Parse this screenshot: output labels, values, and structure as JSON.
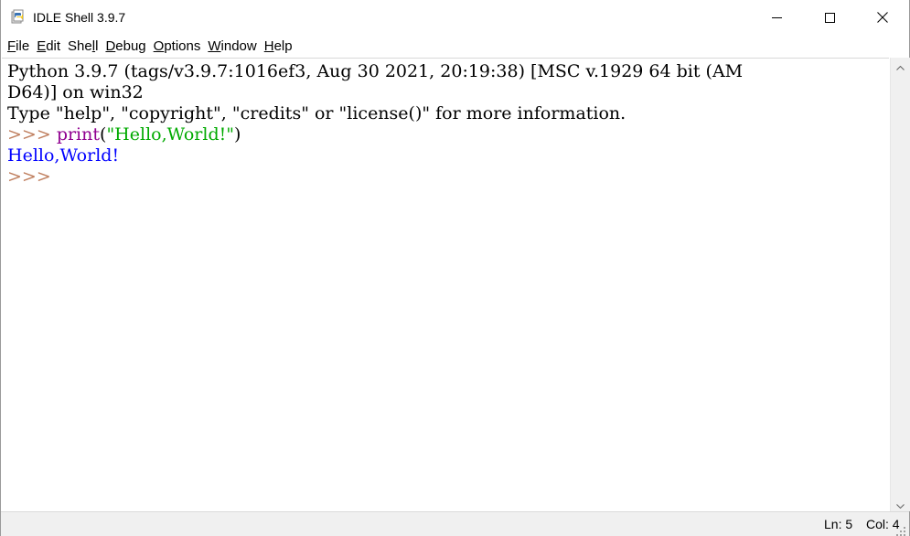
{
  "window": {
    "title": "IDLE Shell 3.9.7"
  },
  "icons": {
    "app": "python-idle-icon",
    "minimize": "minimize-icon",
    "maximize": "maximize-icon",
    "close": "close-icon",
    "scroll_up": "arrow-up-icon",
    "scroll_down": "arrow-down-icon",
    "grip": "resize-grip-icon"
  },
  "menu": {
    "items": [
      {
        "first": "F",
        "rest": "ile"
      },
      {
        "first": "E",
        "rest": "dit"
      },
      {
        "pre": "She",
        "first": "l",
        "rest": "l"
      },
      {
        "first": "D",
        "rest": "ebug"
      },
      {
        "first": "O",
        "rest": "ptions"
      },
      {
        "first": "W",
        "rest": "indow"
      },
      {
        "first": "H",
        "rest": "elp"
      }
    ]
  },
  "shell": {
    "banner_line1": "Python 3.9.7 (tags/v3.9.7:1016ef3, Aug 30 2021, 20:19:38) [MSC v.1929 64 bit (AM",
    "banner_line2": "D64)] on win32",
    "banner_line3": "Type \"help\", \"copyright\", \"credits\" or \"license()\" for more information.",
    "prompt": ">>> ",
    "cmd_builtin": "print",
    "cmd_open": "(",
    "cmd_string": "\"Hello,World!\"",
    "cmd_close": ")",
    "output": "Hello,World!",
    "prompt2": ">>>"
  },
  "status": {
    "ln": "Ln: 5",
    "col": "Col: 4"
  },
  "colors": {
    "prompt": "#c08060",
    "builtin": "#900090",
    "string": "#00aa00",
    "output": "#0000ff"
  }
}
